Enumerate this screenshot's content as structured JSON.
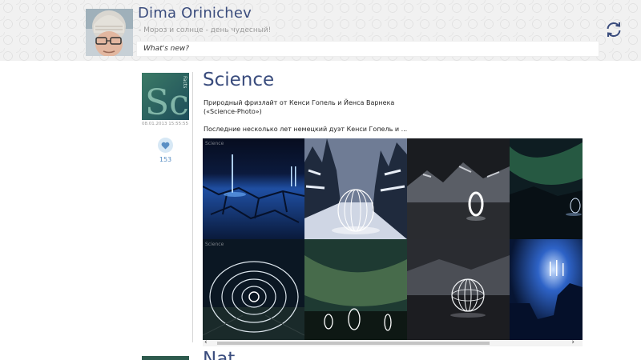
{
  "profile": {
    "name": "Dima Orinichev",
    "status": "- Мороз и солнце - день чудесный!",
    "whats_new_placeholder": "What's new?"
  },
  "post": {
    "title": "Science",
    "thumb_text": "Sc",
    "thumb_side_text": "Facts",
    "date": "08.01.2013 15:55:55",
    "likes": "153",
    "text": "Природный фризлайт от Кенси Гопель и Йенса Варнека («Science-Photo»)",
    "excerpt": "Последние несколько лет немецкий дуэт Кенси Гопель и ...",
    "photo_label": "Science",
    "photos": [
      "salt-flat-lights",
      "snow-forest-orb",
      "mountain-ring",
      "aurora-lake",
      "spiral-rings",
      "aurora-rings",
      "dark-orb",
      "blue-rock-arch"
    ]
  },
  "next_post": {
    "title": "Nat"
  },
  "icons": {
    "refresh": "refresh-icon",
    "like": "heart-icon",
    "scroll_left": "chevron-left-icon",
    "scroll_right": "chevron-right-icon"
  },
  "colors": {
    "title_blue": "#3a4c7d",
    "like_blue": "#5a8fc4"
  }
}
